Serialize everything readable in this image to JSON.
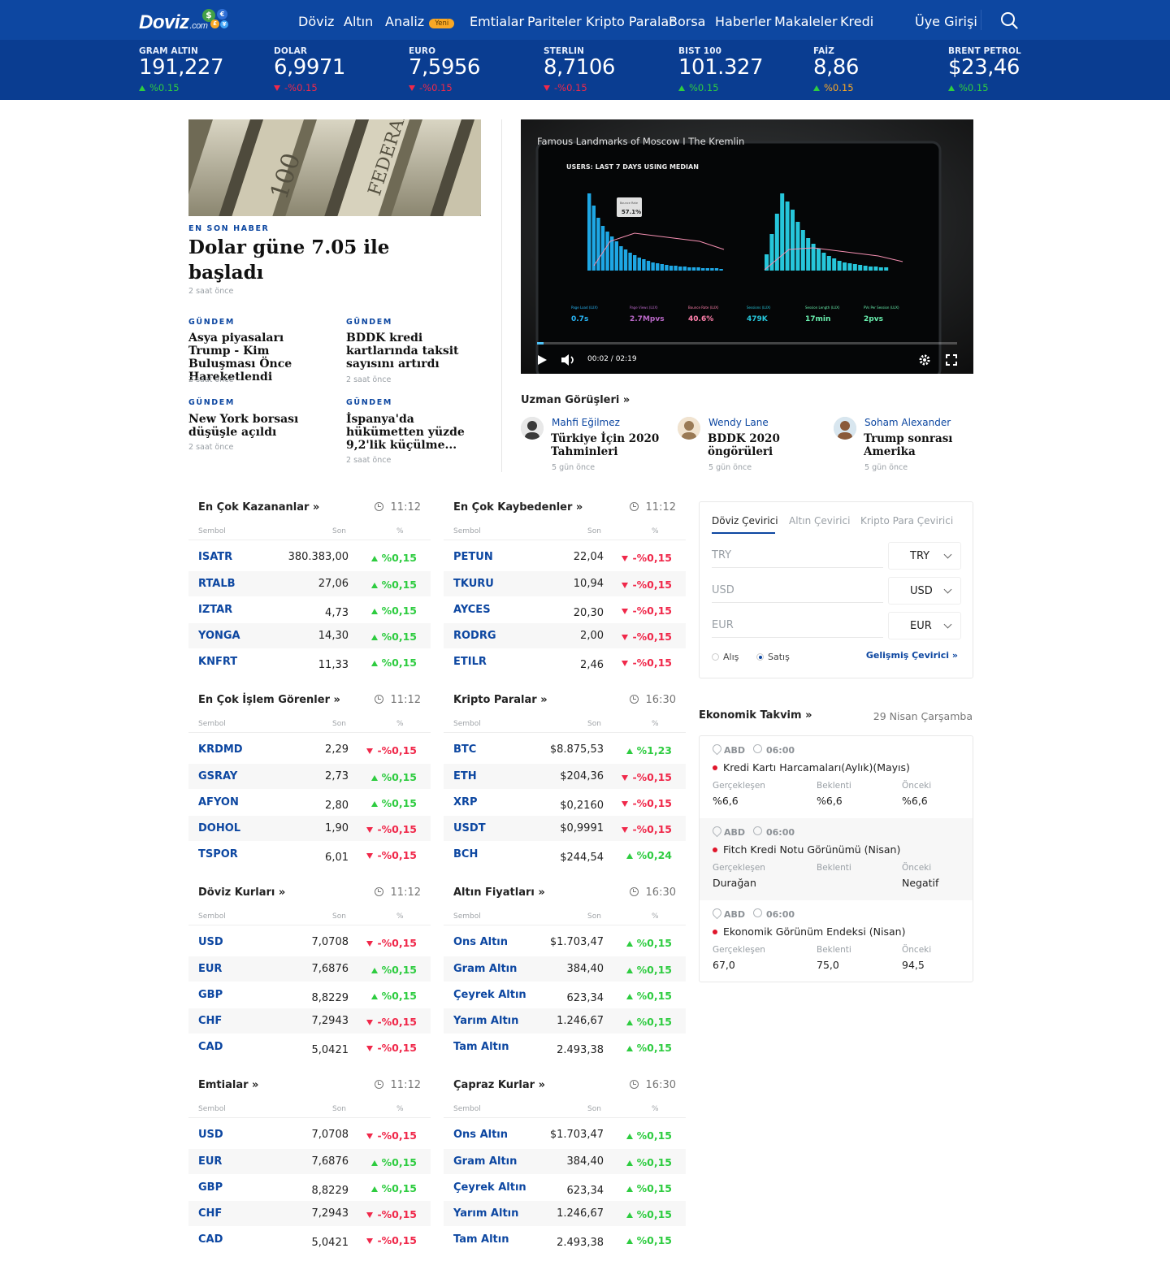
{
  "header": {
    "logo_text": "Doviz",
    "logo_suffix": ".com",
    "nav": [
      {
        "label": "Döviz"
      },
      {
        "label": "Altın"
      },
      {
        "label": "Analiz",
        "badge": "Yeni"
      },
      {
        "label": "Emtialar"
      },
      {
        "label": "Pariteler"
      },
      {
        "label": "Kripto Paralar"
      },
      {
        "label": "Borsa"
      },
      {
        "label": "Haberler"
      },
      {
        "label": "Makaleler"
      },
      {
        "label": "Kredi"
      }
    ],
    "login": "Üye Girişi",
    "search_icon": "search-icon"
  },
  "ticker": [
    {
      "label": "GRAM ALTIN",
      "value": "191,227",
      "change": "%0.15",
      "dir": "up"
    },
    {
      "label": "DOLAR",
      "value": "6,9971",
      "change": "-%0.15",
      "dir": "down"
    },
    {
      "label": "EURO",
      "value": "7,5956",
      "change": "-%0.15",
      "dir": "down"
    },
    {
      "label": "STERLIN",
      "value": "8,7106",
      "change": "-%0.15",
      "dir": "down"
    },
    {
      "label": "BIST 100",
      "value": "101.327",
      "change": "%0.15",
      "dir": "up"
    },
    {
      "label": "FAİZ",
      "value": "8,86",
      "change": "%0.15",
      "dir": "up-yellow"
    },
    {
      "label": "BRENT PETROL",
      "value": "$23,46",
      "change": "%0.15",
      "dir": "up"
    }
  ],
  "news": {
    "main": {
      "kicker": "EN SON HABER",
      "title": "Dolar güne 7.05 ile başladı",
      "time": "2 saat önce"
    },
    "items": [
      {
        "kicker": "GÜNDEM",
        "title": "Asya piyasaları Trump - Kim Buluşması Önce Hareketlendi",
        "time": "2 saat önce"
      },
      {
        "kicker": "GÜNDEM",
        "title": "BDDK kredi kartlarında taksit sayısını artırdı",
        "time": "2 saat önce"
      },
      {
        "kicker": "GÜNDEM",
        "title": "New York borsası düşüşle açıldı",
        "time": "2 saat önce"
      },
      {
        "kicker": "GÜNDEM",
        "title": "İspanya'da hükümetten yüzde 9,2'lik küçülme...",
        "time": "2 saat önce"
      }
    ]
  },
  "video": {
    "title": "Famous Landmarks of Moscow I The Kremlin",
    "time": "00:02 / 02:19",
    "progress": 0.015,
    "screen": {
      "header": "USERS: LAST 7 DAYS USING MEDIAN",
      "tooltip_label": "Bounce Rate",
      "tooltip_value": "57.1%",
      "stats": [
        {
          "label": "Page Load (LUX)",
          "value": "0.7s",
          "color": "#29b6f6"
        },
        {
          "label": "Page Views (LUX)",
          "value": "2.7Mpvs",
          "color": "#ba68c8"
        },
        {
          "label": "Bounce Rate (LUX)",
          "value": "40.6%",
          "color": "#ff80ab"
        },
        {
          "label": "Sessions (LUX)",
          "value": "479K",
          "color": "#26c6da"
        },
        {
          "label": "Session Length (LUX)",
          "value": "17min",
          "color": "#69f0ae"
        },
        {
          "label": "PVs Per Session (LUX)",
          "value": "2pvs",
          "color": "#69f0ae"
        }
      ]
    }
  },
  "experts": {
    "title": "Uzman Görüşleri »",
    "items": [
      {
        "name": "Mahfi Eğilmez",
        "title": "Türkiye İçin 2020 Tahminleri",
        "time": "5 gün önce"
      },
      {
        "name": "Wendy Lane",
        "title": "BDDK 2020 öngörüleri",
        "time": "5 gün önce"
      },
      {
        "name": "Soham Alexander",
        "title": "Trump sonrası Amerika",
        "time": "5 gün önce"
      }
    ]
  },
  "columns": {
    "symbol": "Sembol",
    "last": "Son",
    "pct": "%"
  },
  "tables": [
    {
      "title": "En Çok Kazananlar  »",
      "time": "11:12",
      "rows": [
        {
          "sym": "ISATR",
          "val": "380.383,00",
          "pct": "%0,15",
          "dir": "up"
        },
        {
          "sym": "RTALB",
          "val": "27,06",
          "pct": "%0,15",
          "dir": "up"
        },
        {
          "sym": "IZTAR",
          "val": "4,73",
          "pct": "%0,15",
          "dir": "up"
        },
        {
          "sym": "YONGA",
          "val": "14,30",
          "pct": "%0,15",
          "dir": "up"
        },
        {
          "sym": "KNFRT",
          "val": "11,33",
          "pct": "%0,15",
          "dir": "up"
        }
      ]
    },
    {
      "title": "En Çok Kaybedenler  »",
      "time": "11:12",
      "rows": [
        {
          "sym": "PETUN",
          "val": "22,04",
          "pct": "-%0,15",
          "dir": "down"
        },
        {
          "sym": "TKURU",
          "val": "10,94",
          "pct": "-%0,15",
          "dir": "down"
        },
        {
          "sym": "AYCES",
          "val": "20,30",
          "pct": "-%0,15",
          "dir": "down"
        },
        {
          "sym": "RODRG",
          "val": "2,00",
          "pct": "-%0,15",
          "dir": "down"
        },
        {
          "sym": "ETILR",
          "val": "2,46",
          "pct": "-%0,15",
          "dir": "down"
        }
      ]
    },
    {
      "title": "En Çok İşlem Görenler  »",
      "time": "11:12",
      "rows": [
        {
          "sym": "KRDMD",
          "val": "2,29",
          "pct": "-%0,15",
          "dir": "down"
        },
        {
          "sym": "GSRAY",
          "val": "2,73",
          "pct": "%0,15",
          "dir": "up"
        },
        {
          "sym": "AFYON",
          "val": "2,80",
          "pct": "%0,15",
          "dir": "up"
        },
        {
          "sym": "DOHOL",
          "val": "1,90",
          "pct": "-%0,15",
          "dir": "down"
        },
        {
          "sym": "TSPOR",
          "val": "6,01",
          "pct": "-%0,15",
          "dir": "down"
        }
      ]
    },
    {
      "title": "Kripto Paralar  »",
      "time": "16:30",
      "rows": [
        {
          "sym": "BTC",
          "val": "$8.875,53",
          "pct": "%1,23",
          "dir": "up"
        },
        {
          "sym": "ETH",
          "val": "$204,36",
          "pct": "-%0,15",
          "dir": "down"
        },
        {
          "sym": "XRP",
          "val": "$0,2160",
          "pct": "-%0,15",
          "dir": "down"
        },
        {
          "sym": "USDT",
          "val": "$0,9991",
          "pct": "-%0,15",
          "dir": "down"
        },
        {
          "sym": "BCH",
          "val": "$244,54",
          "pct": "%0,24",
          "dir": "up"
        }
      ]
    },
    {
      "title": "Döviz Kurları  »",
      "time": "11:12",
      "rows": [
        {
          "sym": "USD",
          "val": "7,0708",
          "pct": "-%0,15",
          "dir": "down"
        },
        {
          "sym": "EUR",
          "val": "7,6876",
          "pct": "%0,15",
          "dir": "up"
        },
        {
          "sym": "GBP",
          "val": "8,8229",
          "pct": "%0,15",
          "dir": "up"
        },
        {
          "sym": "CHF",
          "val": "7,2943",
          "pct": "-%0,15",
          "dir": "down"
        },
        {
          "sym": "CAD",
          "val": "5,0421",
          "pct": "-%0,15",
          "dir": "down"
        }
      ]
    },
    {
      "title": "Altın Fiyatları  »",
      "time": "16:30",
      "rows": [
        {
          "sym": "Ons Altın",
          "val": "$1.703,47",
          "pct": "%0,15",
          "dir": "up"
        },
        {
          "sym": "Gram Altın",
          "val": "384,40",
          "pct": "%0,15",
          "dir": "up"
        },
        {
          "sym": "Çeyrek Altın",
          "val": "623,34",
          "pct": "%0,15",
          "dir": "up"
        },
        {
          "sym": "Yarım Altın",
          "val": "1.246,67",
          "pct": "%0,15",
          "dir": "up"
        },
        {
          "sym": "Tam Altın",
          "val": "2.493,38",
          "pct": "%0,15",
          "dir": "up"
        }
      ]
    },
    {
      "title": "Emtialar »",
      "time": "11:12",
      "rows": [
        {
          "sym": "USD",
          "val": "7,0708",
          "pct": "-%0,15",
          "dir": "down"
        },
        {
          "sym": "EUR",
          "val": "7,6876",
          "pct": "%0,15",
          "dir": "up"
        },
        {
          "sym": "GBP",
          "val": "8,8229",
          "pct": "%0,15",
          "dir": "up"
        },
        {
          "sym": "CHF",
          "val": "7,2943",
          "pct": "-%0,15",
          "dir": "down"
        },
        {
          "sym": "CAD",
          "val": "5,0421",
          "pct": "-%0,15",
          "dir": "down"
        }
      ]
    },
    {
      "title": "Çapraz Kurlar  »",
      "time": "16:30",
      "rows": [
        {
          "sym": "Ons Altın",
          "val": "$1.703,47",
          "pct": "%0,15",
          "dir": "up"
        },
        {
          "sym": "Gram Altın",
          "val": "384,40",
          "pct": "%0,15",
          "dir": "up"
        },
        {
          "sym": "Çeyrek Altın",
          "val": "623,34",
          "pct": "%0,15",
          "dir": "up"
        },
        {
          "sym": "Yarım Altın",
          "val": "1.246,67",
          "pct": "%0,15",
          "dir": "up"
        },
        {
          "sym": "Tam Altın",
          "val": "2.493,38",
          "pct": "%0,15",
          "dir": "up"
        }
      ]
    }
  ],
  "converter": {
    "tabs": [
      "Döviz Çevirici",
      "Altın Çevirici",
      "Kripto Para Çevirici"
    ],
    "fields": [
      {
        "placeholder": "TRY",
        "currency": "TRY"
      },
      {
        "placeholder": "USD",
        "currency": "USD"
      },
      {
        "placeholder": "EUR",
        "currency": "EUR"
      }
    ],
    "radio_buy": "Alış",
    "radio_sell": "Satış",
    "selected": "Satış",
    "advanced": "Gelişmiş Çevirici »"
  },
  "calendar": {
    "title": "Ekonomik Takvim »",
    "date": "29 Nisan Çarşamba",
    "labels": {
      "actual": "Gerçekleşen",
      "expected": "Beklenti",
      "previous": "Önceki"
    },
    "items": [
      {
        "country": "ABD",
        "time": "06:00",
        "title": "Kredi Kartı Harcamaları(Aylık)(Mayıs)",
        "actual": "%6,6",
        "expected": "%6,6",
        "previous": "%6,6"
      },
      {
        "country": "ABD",
        "time": "06:00",
        "title": "Fitch Kredi Notu Görünümü (Nisan)",
        "actual": "Durağan",
        "expected": "",
        "previous": "Negatif"
      },
      {
        "country": "ABD",
        "time": "06:00",
        "title": "Ekonomik Görünüm Endeksi (Nisan)",
        "actual": "67,0",
        "expected": "75,0",
        "previous": "94,5"
      }
    ]
  },
  "colors": {
    "brand": "#0d47a1",
    "up": "#2ecc40",
    "down": "#f0284a",
    "faiz": "#f9a825"
  }
}
